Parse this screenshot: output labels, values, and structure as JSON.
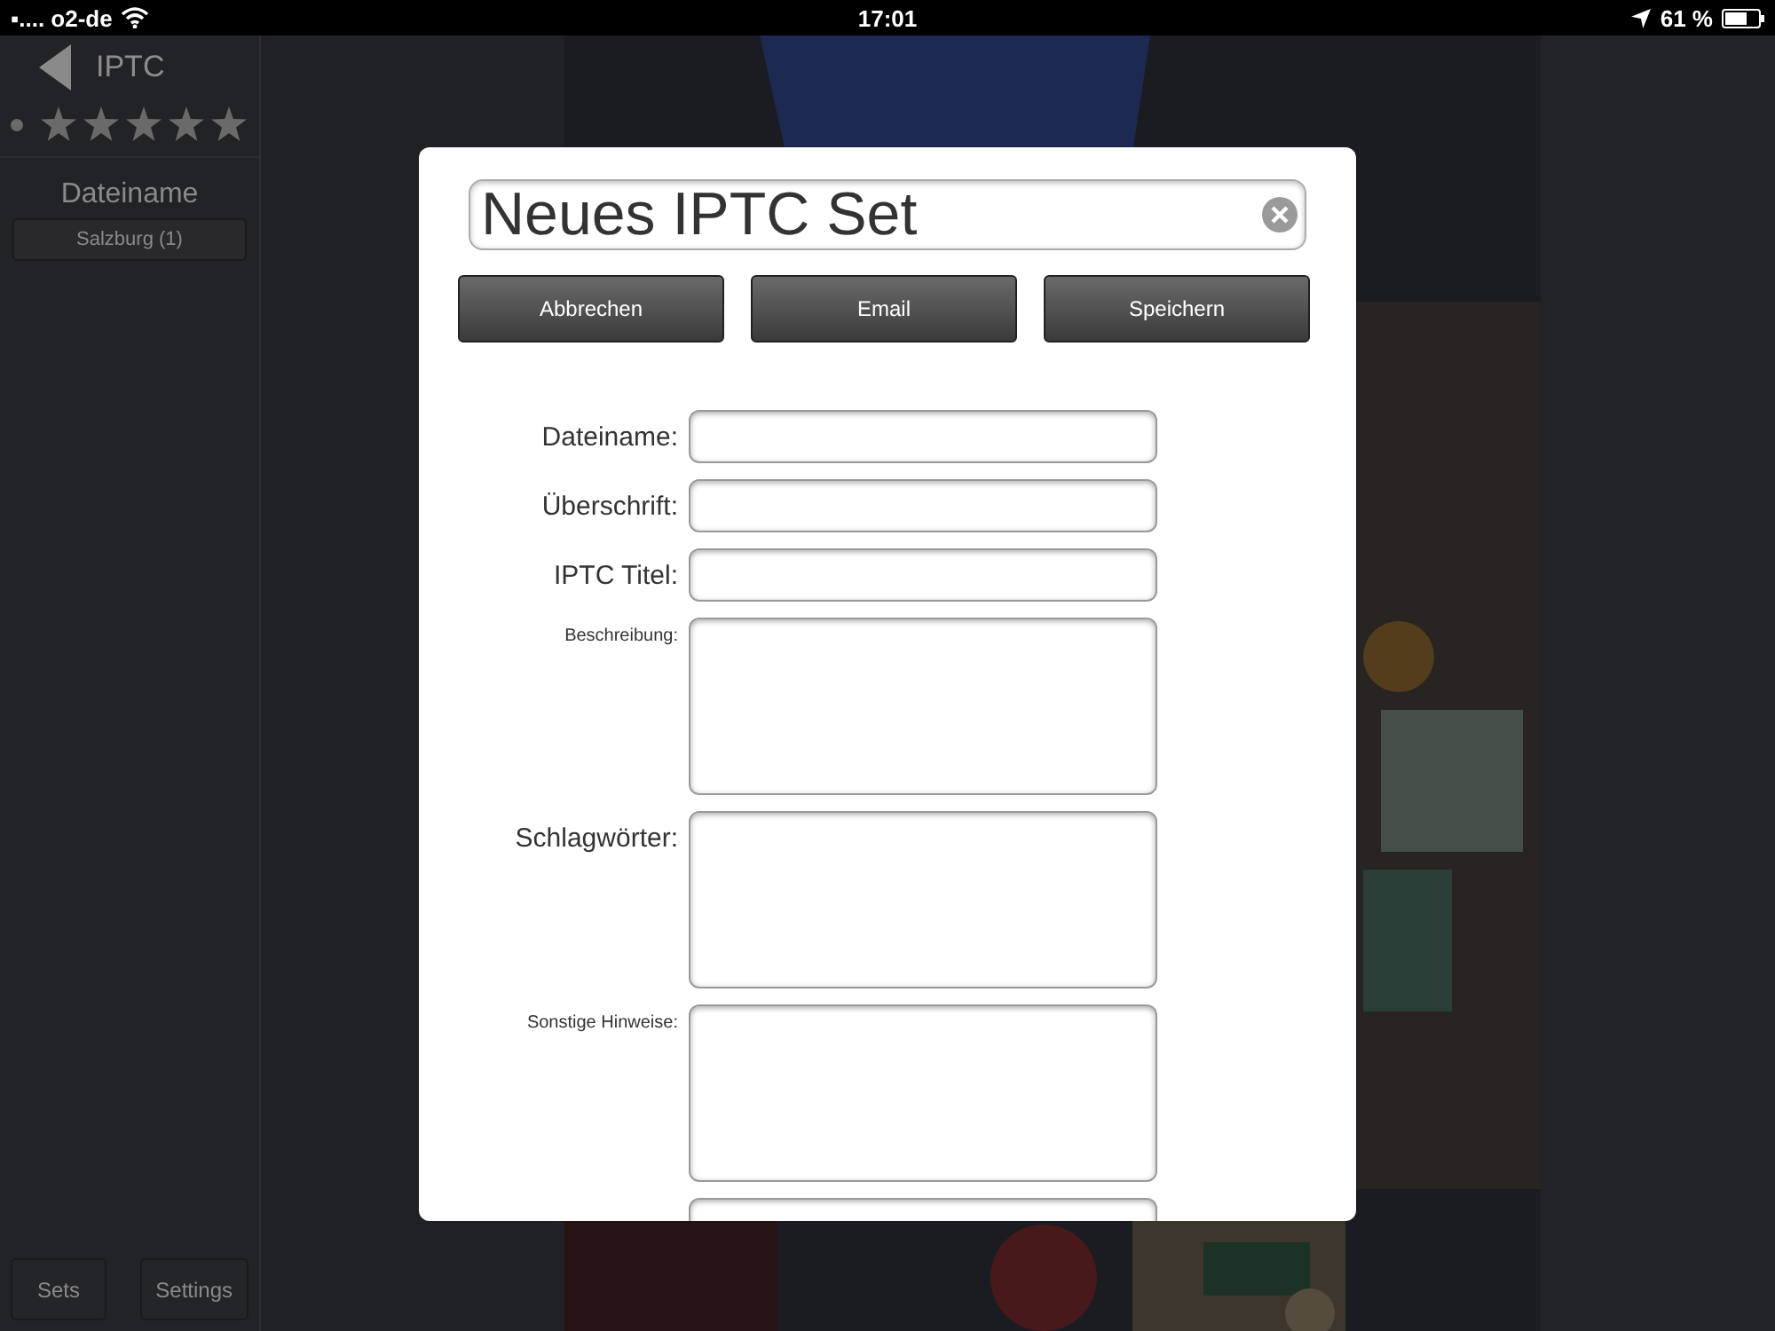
{
  "status_bar": {
    "carrier": "▪.... o2-de",
    "time": "17:01",
    "battery": "61 %"
  },
  "sidebar": {
    "title": "IPTC",
    "stars": 0,
    "section": "Dateiname",
    "items": [
      {
        "label": "Salzburg (1)",
        "selected": false
      }
    ],
    "buttons": [
      "Sets",
      "Settings"
    ]
  },
  "dialog": {
    "title": "Neues IPTC Set",
    "buttons": [
      "Abbrechen",
      "Email",
      "Speichern"
    ],
    "fields": [
      {
        "label": "Dateiname:",
        "kind": "line"
      },
      {
        "label": "Überschrift:",
        "kind": "line"
      },
      {
        "label": "IPTC Titel:",
        "kind": "line"
      },
      {
        "label": "Beschreibung:",
        "kind": "area-compact"
      },
      {
        "label": "Schlagwörter:",
        "kind": "area"
      },
      {
        "label": "Sonstige Hinweise:",
        "kind": "area-compact"
      },
      {
        "kind": "line"
      }
    ]
  }
}
